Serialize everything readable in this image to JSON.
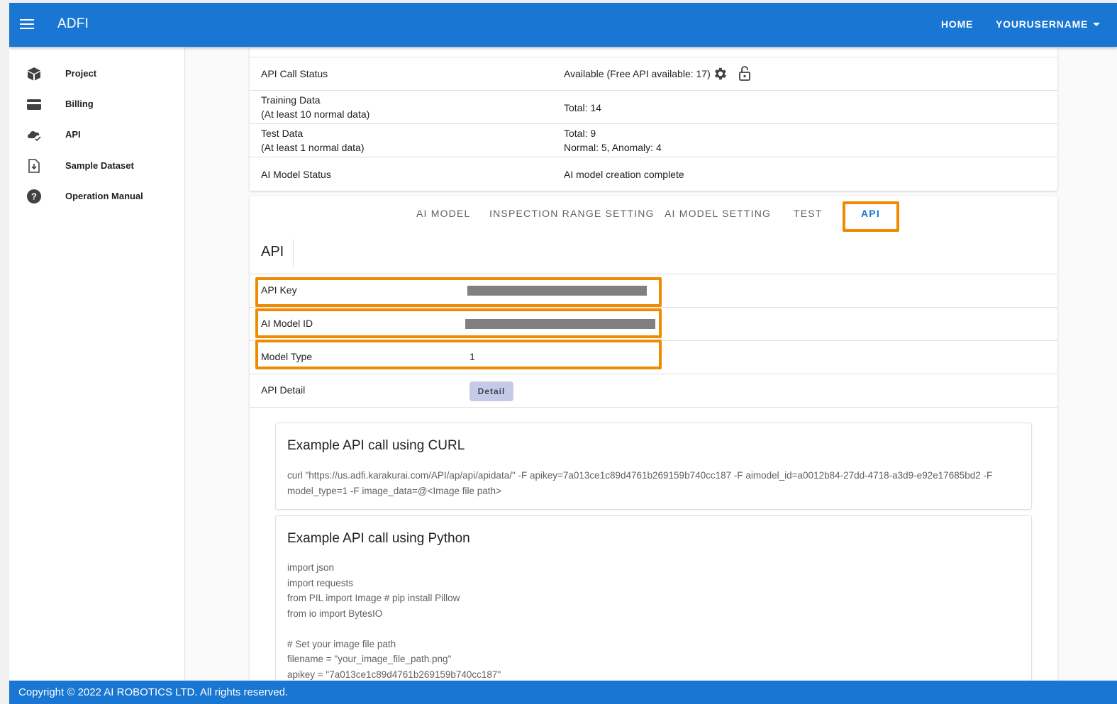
{
  "header": {
    "app_title": "ADFI",
    "nav_home": "HOME",
    "nav_user": "YOURUSERNAME"
  },
  "sidebar": {
    "items": [
      {
        "label": "Project",
        "icon": "cube-icon"
      },
      {
        "label": "Billing",
        "icon": "credit-card-icon"
      },
      {
        "label": "API",
        "icon": "cloud-check-icon"
      },
      {
        "label": "Sample Dataset",
        "icon": "file-download-icon"
      },
      {
        "label": "Operation Manual",
        "icon": "help-circle-icon"
      }
    ]
  },
  "status": {
    "rows": [
      {
        "key": "API Call Status",
        "value": "Available (Free API available: 17)"
      },
      {
        "key_line1": "Training Data",
        "key_line2": "(At least 10 normal data)",
        "value": "Total: 14"
      },
      {
        "key_line1": "Test Data",
        "key_line2": "(At least 1 normal data)",
        "value_line1": "Total: 9",
        "value_line2": "Normal: 5, Anomaly: 4"
      },
      {
        "key": "AI Model Status",
        "value": "AI model creation complete"
      }
    ]
  },
  "tabs": [
    "AI MODEL",
    "INSPECTION RANGE SETTING",
    "AI MODEL SETTING",
    "TEST",
    "API"
  ],
  "api_section": {
    "title": "API",
    "rows": {
      "api_key_label": "API Key",
      "model_id_label": "AI Model ID",
      "model_type_label": "Model Type",
      "model_type_value": "1",
      "detail_label": "API Detail",
      "detail_button": "Detail"
    }
  },
  "examples": {
    "curl_title": "Example API call using CURL",
    "curl_line1": "curl \"https://us.adfi.karakurai.com/API/ap/api/apidata/\" -F apikey=7a013ce1c89d4761b269159b740cc187 -F aimodel_id=a0012b84-27dd-4718-a3d9-e92e17685bd2 -F",
    "curl_line2": "model_type=1 -F image_data=@<Image file path>",
    "python_title": "Example API call using Python",
    "python_lines": [
      "import json",
      "import requests",
      "from PIL import Image # pip install Pillow",
      "from io import BytesIO",
      "",
      "# Set your image file path",
      "filename = \"your_image_file_path.png\"",
      "apikey = \"7a013ce1c89d4761b269159b740cc187\""
    ]
  },
  "footer": {
    "copyright": "Copyright © 2022 AI ROBOTICS LTD. All rights reserved."
  },
  "colors": {
    "primary": "#1976d2",
    "highlight": "#f08a00",
    "detail_button_bg": "#c5cae9",
    "masked": "#808080"
  }
}
